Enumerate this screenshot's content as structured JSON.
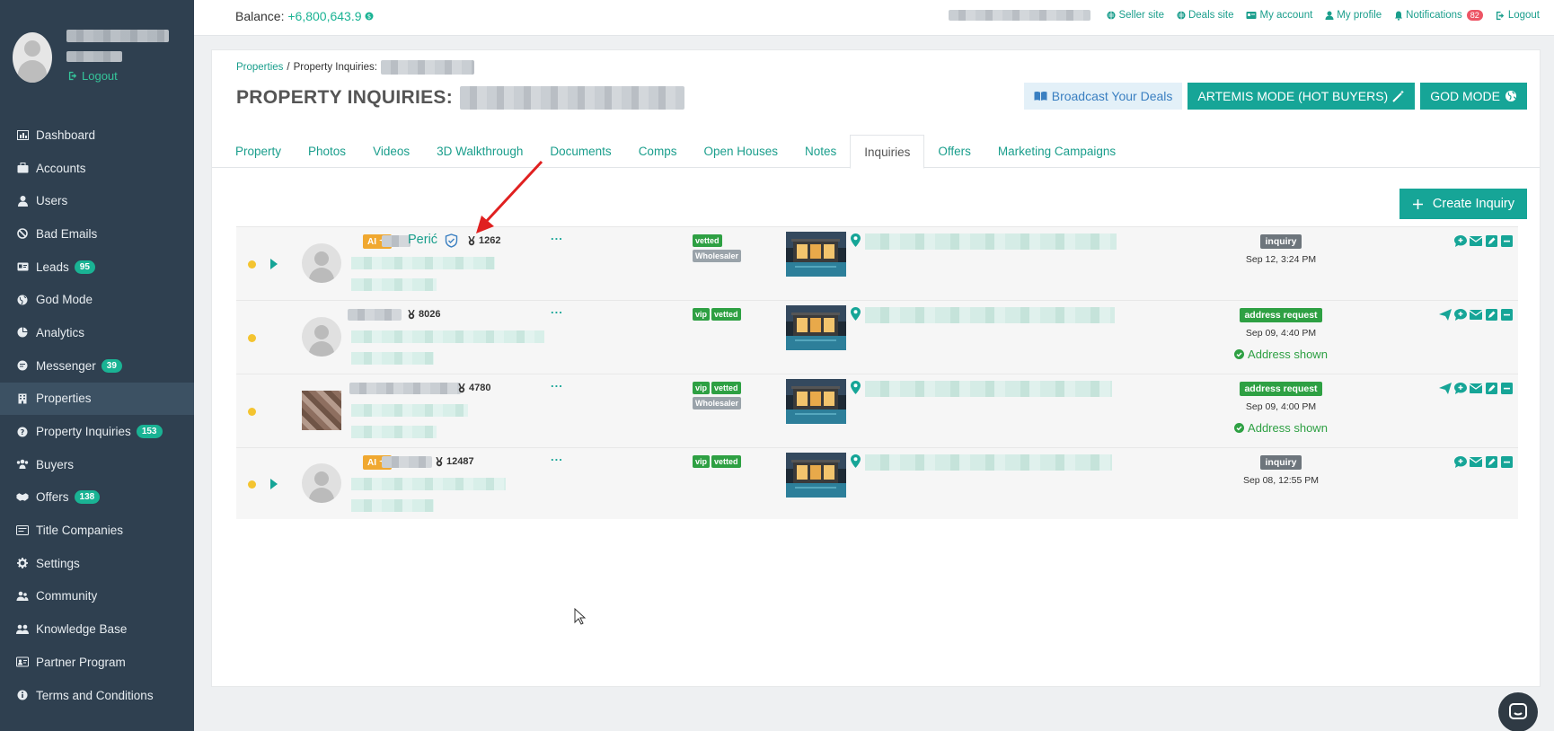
{
  "sidebar": {
    "logout_label": "Logout",
    "items": [
      {
        "label": "Dashboard",
        "icon": "dashboard-icon",
        "badge": ""
      },
      {
        "label": "Accounts",
        "icon": "briefcase-icon",
        "badge": ""
      },
      {
        "label": "Users",
        "icon": "user-icon",
        "badge": ""
      },
      {
        "label": "Bad Emails",
        "icon": "ban-icon",
        "badge": ""
      },
      {
        "label": "Leads",
        "icon": "id-card-icon",
        "badge": "95"
      },
      {
        "label": "God Mode",
        "icon": "globe-icon",
        "badge": ""
      },
      {
        "label": "Analytics",
        "icon": "pie-chart-icon",
        "badge": ""
      },
      {
        "label": "Messenger",
        "icon": "chat-icon",
        "badge": "39"
      },
      {
        "label": "Properties",
        "icon": "building-icon",
        "badge": ""
      },
      {
        "label": "Property Inquiries",
        "icon": "question-icon",
        "badge": "153"
      },
      {
        "label": "Buyers",
        "icon": "buyers-icon",
        "badge": ""
      },
      {
        "label": "Offers",
        "icon": "handshake-icon",
        "badge": "138"
      },
      {
        "label": "Title Companies",
        "icon": "title-company-icon",
        "badge": ""
      },
      {
        "label": "Settings",
        "icon": "gear-icon",
        "badge": ""
      },
      {
        "label": "Community",
        "icon": "community-icon",
        "badge": ""
      },
      {
        "label": "Knowledge Base",
        "icon": "knowledge-icon",
        "badge": ""
      },
      {
        "label": "Partner Program",
        "icon": "partner-icon",
        "badge": ""
      },
      {
        "label": "Terms and Conditions",
        "icon": "info-icon",
        "badge": ""
      }
    ],
    "active_item": "Properties"
  },
  "topbar": {
    "balance_label": "Balance:",
    "balance_value": "+6,800,643.9",
    "links": {
      "seller_site": "Seller site",
      "deals_site": "Deals site",
      "my_account": "My account",
      "my_profile": "My profile",
      "notifications": "Notifications",
      "notifications_count": "82",
      "logout": "Logout"
    }
  },
  "header": {
    "breadcrumb_root": "Properties",
    "breadcrumb_sep": "/",
    "breadcrumb_current": "Property Inquiries:",
    "page_title": "PROPERTY INQUIRIES:",
    "broadcast_label": "Broadcast Your Deals",
    "artemis_label": "ARTEMIS MODE (HOT BUYERS)",
    "god_mode_label": "GOD MODE"
  },
  "tabs": [
    {
      "label": "Property",
      "active": false
    },
    {
      "label": "Photos",
      "active": false
    },
    {
      "label": "Videos",
      "active": false
    },
    {
      "label": "3D Walkthrough",
      "active": false
    },
    {
      "label": "Documents",
      "active": false
    },
    {
      "label": "Comps",
      "active": false
    },
    {
      "label": "Open Houses",
      "active": false
    },
    {
      "label": "Notes",
      "active": false
    },
    {
      "label": "Inquiries",
      "active": true
    },
    {
      "label": "Offers",
      "active": false
    },
    {
      "label": "Marketing Campaigns",
      "active": false
    }
  ],
  "create_inquiry_label": "Create Inquiry",
  "inquiries": [
    {
      "ai_label": "AI",
      "name": "Perić",
      "verified": true,
      "score": "1262",
      "more": "...",
      "tags": [
        [
          "vetted"
        ],
        [
          "Wholesaler"
        ]
      ],
      "status": "inquiry",
      "date": "Sep 12, 3:24 PM",
      "address_shown": ""
    },
    {
      "ai_label": "",
      "name": "",
      "verified": false,
      "score": "8026",
      "more": "...",
      "tags": [
        [
          "vip",
          "vetted"
        ]
      ],
      "status": "address request",
      "date": "Sep 09, 4:40 PM",
      "address_shown": "Address shown"
    },
    {
      "ai_label": "",
      "name": "",
      "verified": false,
      "score": "4780",
      "more": "...",
      "tags": [
        [
          "vip",
          "vetted"
        ],
        [
          "Wholesaler"
        ]
      ],
      "status": "address request",
      "date": "Sep 09, 4:00 PM",
      "address_shown": "Address shown"
    },
    {
      "ai_label": "AI",
      "name": "",
      "verified": false,
      "score": "12487",
      "more": "...",
      "tags": [
        [
          "vip",
          "vetted"
        ]
      ],
      "status": "inquiry",
      "date": "Sep 08, 12:55 PM",
      "address_shown": ""
    }
  ],
  "colors": {
    "sidebar_bg": "#2f4050",
    "accent": "#16a597",
    "link": "#1a9e8c",
    "badge_red": "#ed5565",
    "tag_green": "#2ea043",
    "ai_orange": "#f0a830",
    "annotation_arrow": "#e02020"
  }
}
